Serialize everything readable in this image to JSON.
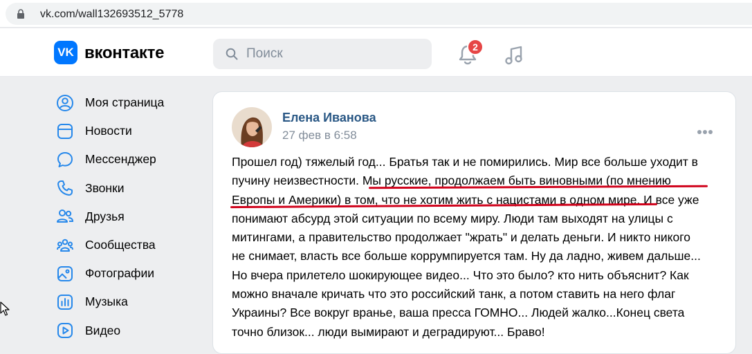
{
  "browser": {
    "url": "vk.com/wall132693512_5778"
  },
  "header": {
    "logo_text": "вконтакте",
    "logo_mark": "VK",
    "search_placeholder": "Поиск",
    "notifications_count": "2"
  },
  "sidebar": {
    "items": [
      {
        "label": "Моя страница",
        "icon": "user-circle-icon"
      },
      {
        "label": "Новости",
        "icon": "news-icon"
      },
      {
        "label": "Мессенджер",
        "icon": "chat-bubble-icon"
      },
      {
        "label": "Звонки",
        "icon": "phone-icon"
      },
      {
        "label": "Друзья",
        "icon": "friends-icon"
      },
      {
        "label": "Сообщества",
        "icon": "communities-icon"
      },
      {
        "label": "Фотографии",
        "icon": "photo-icon"
      },
      {
        "label": "Музыка",
        "icon": "music-icon"
      },
      {
        "label": "Видео",
        "icon": "video-icon"
      }
    ]
  },
  "post": {
    "author": "Елена Иванова",
    "date": "27 фев в 6:58",
    "lines": [
      "Прошел год) тяжелый год... Братья так и не помирились. Мир все больше уходит в",
      "пучину неизвестности. Мы русские, продолжаем быть виновными (по мнению",
      "Европы и Америки) в том, что не хотим жить с нацистами в одном мире. И все уже",
      "понимают абсурд этой ситуации по всему миру. Люди там выходят на улицы с",
      "митингами, а правительство продолжает \"жрать\" и делать деньги. И никто никого",
      "не снимает, власть все больше коррумпируется там. Ну да ладно, живем дальше...",
      "Но вчера прилетело шокирующее видео... Что это было? кто нить объяснит? Как",
      "можно вначале кричать что это российский танк, а потом ставить на него флаг",
      "Украины? Все вокруг вранье, ваша пресса ГОМНО... Людей жалко...Конец света",
      "точно близок... люди вымирают и деградируют... Браво!"
    ]
  },
  "colors": {
    "accent": "#0077ff",
    "link": "#2a5885",
    "underline": "#d0021b",
    "badge": "#e64646"
  }
}
